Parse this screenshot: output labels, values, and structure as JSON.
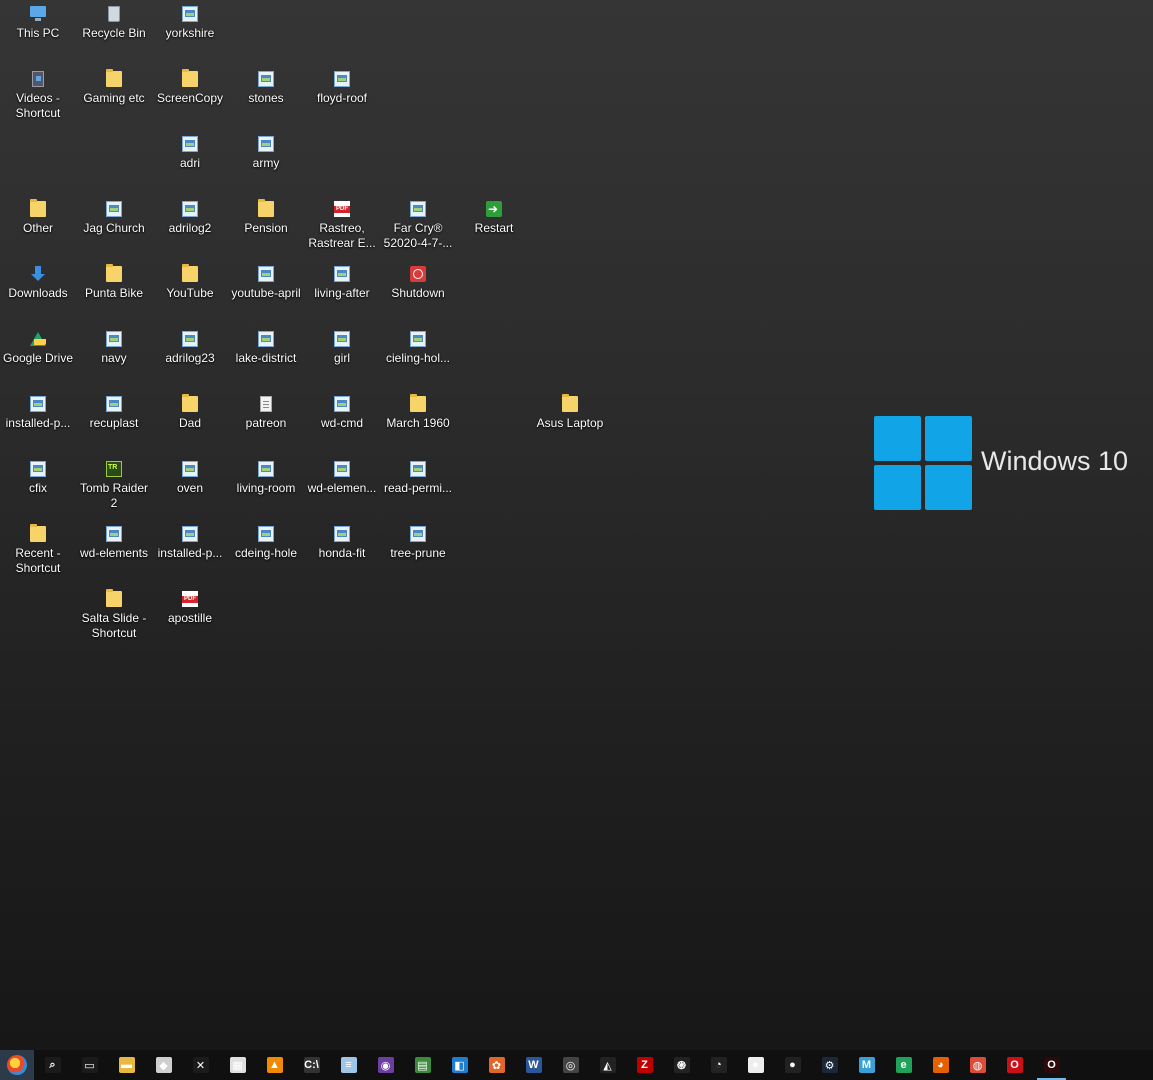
{
  "desktop": {
    "icons": [
      {
        "label": "This PC",
        "type": "thispc",
        "col": 0,
        "row": 0
      },
      {
        "label": "Recycle Bin",
        "type": "recycle",
        "col": 1,
        "row": 0
      },
      {
        "label": "yorkshire",
        "type": "image",
        "col": 2,
        "row": 0
      },
      {
        "label": "Videos - Shortcut",
        "type": "video",
        "col": 0,
        "row": 1
      },
      {
        "label": "Gaming etc",
        "type": "folder",
        "col": 1,
        "row": 1
      },
      {
        "label": "ScreenCopy",
        "type": "folder",
        "col": 2,
        "row": 1
      },
      {
        "label": "stones",
        "type": "image",
        "col": 3,
        "row": 1
      },
      {
        "label": "floyd-roof",
        "type": "image",
        "col": 4,
        "row": 1
      },
      {
        "label": "adri",
        "type": "image",
        "col": 2,
        "row": 2
      },
      {
        "label": "army",
        "type": "image",
        "col": 3,
        "row": 2
      },
      {
        "label": "Other",
        "type": "folder",
        "col": 0,
        "row": 3
      },
      {
        "label": "Jag Church",
        "type": "image",
        "col": 1,
        "row": 3
      },
      {
        "label": "adrilog2",
        "type": "image",
        "col": 2,
        "row": 3
      },
      {
        "label": "Pension",
        "type": "folder",
        "col": 3,
        "row": 3
      },
      {
        "label": "Rastreo, Rastrear E...",
        "type": "pdf",
        "col": 4,
        "row": 3
      },
      {
        "label": "Far Cry® 52020-4-7-...",
        "type": "image",
        "col": 5,
        "row": 3
      },
      {
        "label": "Restart",
        "type": "restart",
        "col": 6,
        "row": 3
      },
      {
        "label": "Downloads",
        "type": "download",
        "col": 0,
        "row": 4
      },
      {
        "label": "Punta Bike",
        "type": "folder",
        "col": 1,
        "row": 4
      },
      {
        "label": "YouTube",
        "type": "folder",
        "col": 2,
        "row": 4
      },
      {
        "label": "youtube-april",
        "type": "image",
        "col": 3,
        "row": 4
      },
      {
        "label": "living-after",
        "type": "image",
        "col": 4,
        "row": 4
      },
      {
        "label": "Shutdown",
        "type": "shutdown",
        "col": 5,
        "row": 4
      },
      {
        "label": "Google Drive",
        "type": "gdrive",
        "col": 0,
        "row": 5
      },
      {
        "label": "navy",
        "type": "image",
        "col": 1,
        "row": 5
      },
      {
        "label": "adrilog23",
        "type": "image",
        "col": 2,
        "row": 5
      },
      {
        "label": "lake-district",
        "type": "image",
        "col": 3,
        "row": 5
      },
      {
        "label": "girl",
        "type": "image",
        "col": 4,
        "row": 5
      },
      {
        "label": "cieling-hol...",
        "type": "image",
        "col": 5,
        "row": 5
      },
      {
        "label": "installed-p...",
        "type": "image",
        "col": 0,
        "row": 6
      },
      {
        "label": "recuplast",
        "type": "image",
        "col": 1,
        "row": 6
      },
      {
        "label": "Dad",
        "type": "folder",
        "col": 2,
        "row": 6
      },
      {
        "label": "patreon",
        "type": "doc",
        "col": 3,
        "row": 6
      },
      {
        "label": "wd-cmd",
        "type": "image",
        "col": 4,
        "row": 6
      },
      {
        "label": "March 1960",
        "type": "folder",
        "col": 5,
        "row": 6
      },
      {
        "label": "Asus Laptop",
        "type": "folder",
        "col": 7,
        "row": 6
      },
      {
        "label": "cfix",
        "type": "image",
        "col": 0,
        "row": 7
      },
      {
        "label": "Tomb Raider 2",
        "type": "game",
        "col": 1,
        "row": 7
      },
      {
        "label": "oven",
        "type": "image",
        "col": 2,
        "row": 7
      },
      {
        "label": "living-room",
        "type": "image",
        "col": 3,
        "row": 7
      },
      {
        "label": "wd-elemen...",
        "type": "image",
        "col": 4,
        "row": 7
      },
      {
        "label": "read-permi...",
        "type": "image",
        "col": 5,
        "row": 7
      },
      {
        "label": "Recent - Shortcut",
        "type": "folder",
        "col": 0,
        "row": 8
      },
      {
        "label": "wd-elements",
        "type": "image",
        "col": 1,
        "row": 8
      },
      {
        "label": "installed-p...",
        "type": "image",
        "col": 2,
        "row": 8
      },
      {
        "label": "cdeing-hole",
        "type": "image",
        "col": 3,
        "row": 8
      },
      {
        "label": "honda-fit",
        "type": "image",
        "col": 4,
        "row": 8
      },
      {
        "label": "tree-prune",
        "type": "image",
        "col": 5,
        "row": 8
      },
      {
        "label": "Salta Slide - Shortcut",
        "type": "folder",
        "col": 1,
        "row": 9
      },
      {
        "label": "apostille",
        "type": "pdf",
        "col": 2,
        "row": 9
      }
    ]
  },
  "wallpaper": {
    "text": "Windows 10",
    "accent": "#11a5e8"
  },
  "taskbar": {
    "items": [
      {
        "name": "start-button-icon",
        "glyph": "",
        "color": ""
      },
      {
        "name": "search-icon",
        "glyph": "⌕",
        "color": "#1b1b1b"
      },
      {
        "name": "task-view-icon",
        "glyph": "▭",
        "color": "#1b1b1b"
      },
      {
        "name": "file-explorer-icon",
        "glyph": "▬",
        "color": "#e8b840"
      },
      {
        "name": "drive-app-icon",
        "glyph": "◆",
        "color": "#cfcfcf"
      },
      {
        "name": "xbox-icon",
        "glyph": "✕",
        "color": "#1b1b1b"
      },
      {
        "name": "calculator-icon",
        "glyph": "▦",
        "color": "#e0e0e0"
      },
      {
        "name": "vlc-icon",
        "glyph": "▲",
        "color": "#f08a00"
      },
      {
        "name": "command-prompt-icon",
        "glyph": "C:\\",
        "color": "#333333"
      },
      {
        "name": "notepad-icon",
        "glyph": "≡",
        "color": "#9ec6e8"
      },
      {
        "name": "app-purple-icon",
        "glyph": "◉",
        "color": "#6a3fa0"
      },
      {
        "name": "app-green-card-icon",
        "glyph": "▤",
        "color": "#3c8a3c"
      },
      {
        "name": "store-icon",
        "glyph": "◧",
        "color": "#1e7fd0"
      },
      {
        "name": "app-orange-icon",
        "glyph": "✿",
        "color": "#e0662a"
      },
      {
        "name": "word-icon",
        "glyph": "W",
        "color": "#2b579a"
      },
      {
        "name": "app-gray-icon",
        "glyph": "◎",
        "color": "#444444"
      },
      {
        "name": "app-inkscape-icon",
        "glyph": "◭",
        "color": "#222222"
      },
      {
        "name": "filezilla-icon",
        "glyph": "Z",
        "color": "#bf0000"
      },
      {
        "name": "app-spiral-icon",
        "glyph": "֍",
        "color": "#222222"
      },
      {
        "name": "speedometer-icon",
        "glyph": "◔",
        "color": "#222222"
      },
      {
        "name": "app-white-circle-icon",
        "glyph": "●",
        "color": "#eeeeee"
      },
      {
        "name": "record-icon",
        "glyph": "●",
        "color": "#222222"
      },
      {
        "name": "steam-icon",
        "glyph": "⚙",
        "color": "#1b2838"
      },
      {
        "name": "app-m-icon",
        "glyph": "M",
        "color": "#3aa0d8"
      },
      {
        "name": "edge-icon",
        "glyph": "e",
        "color": "#1fa35a"
      },
      {
        "name": "firefox-icon",
        "glyph": "◕",
        "color": "#e66000"
      },
      {
        "name": "chrome-icon",
        "glyph": "◍",
        "color": "#dd4b39"
      },
      {
        "name": "opera-icon",
        "glyph": "O",
        "color": "#cc0f16"
      },
      {
        "name": "opera-gx-icon",
        "glyph": "O",
        "color": "#2a0a0a"
      }
    ],
    "active_index": 28
  }
}
